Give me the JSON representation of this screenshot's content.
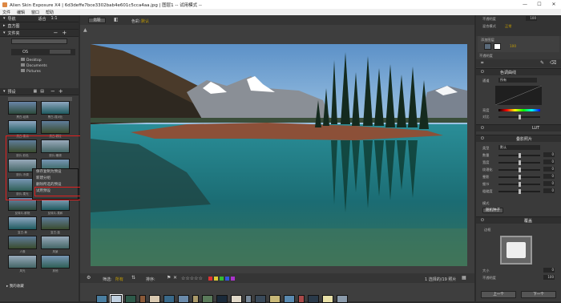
{
  "window": {
    "title": "Alien Skin Exposure X4 | 6d3deffe7bce3302bab4e601c5cca4aa.jpg | 图层1 -- 试用模式 --",
    "minimize": "—",
    "maximize": "☐",
    "close": "✕"
  },
  "menu": [
    "文件",
    "编辑",
    "窗口",
    "帮助"
  ],
  "left": {
    "nav_label": "导航",
    "zoom_values": [
      "适合",
      "1:1"
    ],
    "histogram_label": "直方图",
    "folders_label": "文件夹",
    "search_placeholder": "",
    "drive_label": "OS",
    "drive_info": "",
    "folders": [
      "Desktop",
      "Documents",
      "Pictures"
    ],
    "presets_label": "预设",
    "preset_rows": [
      [
        "黑白-经典",
        "黑白-强对比"
      ],
      [
        "黑白-柔和",
        "黑白-颗粒"
      ],
      [
        "胶片-彩色",
        "胶片-暖调"
      ],
      [
        "胶片-冷调",
        "胶片-褪色"
      ],
      [
        "胶片-柔光",
        "胶片-高对比"
      ],
      [
        "反转片-鲜艳",
        "反转片-柔和"
      ],
      [
        "复古-黄",
        "复古-蓝"
      ],
      [
        "人像",
        "风景"
      ],
      [
        "风光",
        "其他"
      ]
    ],
    "context_menu": [
      "保存复制为预设",
      "新建分组",
      "删除所选的预设",
      "试用预设"
    ],
    "favorites_label": "我的收藏"
  },
  "toolbar": {
    "compare_label": "比较",
    "color_label": "色彩:",
    "color_value": "默认"
  },
  "bottom_bar": {
    "filter_label": "筛选:",
    "filter_value": "所有",
    "sort_label": "排序:",
    "status": "1 选择的/19 照片"
  },
  "right": {
    "opacity_label": "不透明度",
    "opacity_value": "100",
    "blend_label": "混合模式",
    "blend_value": "正常",
    "layer_label": "添加图层",
    "layer_value": "100",
    "opacity2_label": "不透明度",
    "tone_curve_label": "色调曲线",
    "channel_label": "通道",
    "channel_value": "所有",
    "brightness_label": "亮度",
    "contrast_label": "对比",
    "lut_label": "LUT",
    "overlay_section": "叠影照片",
    "overlay_type_label": "类型",
    "overlay_type_value": "默认",
    "sliders": [
      {
        "label": "数量",
        "value": "0"
      },
      {
        "label": "宽度",
        "value": "0"
      },
      {
        "label": "纹理化",
        "value": "0"
      },
      {
        "label": "晕影",
        "value": "0"
      },
      {
        "label": "细节",
        "value": "0"
      },
      {
        "label": "粗糙度",
        "value": "0"
      }
    ],
    "mode_label": "模式",
    "randomize_button": "随机种子",
    "dust_label": "覆盖",
    "edge_label": "边框",
    "size_label": "大小",
    "size_value": "0",
    "opacity3_label": "不透明度",
    "opacity3_value": "100",
    "prev_button": "上一个",
    "next_button": "下一个"
  },
  "accent": "#c8a000"
}
